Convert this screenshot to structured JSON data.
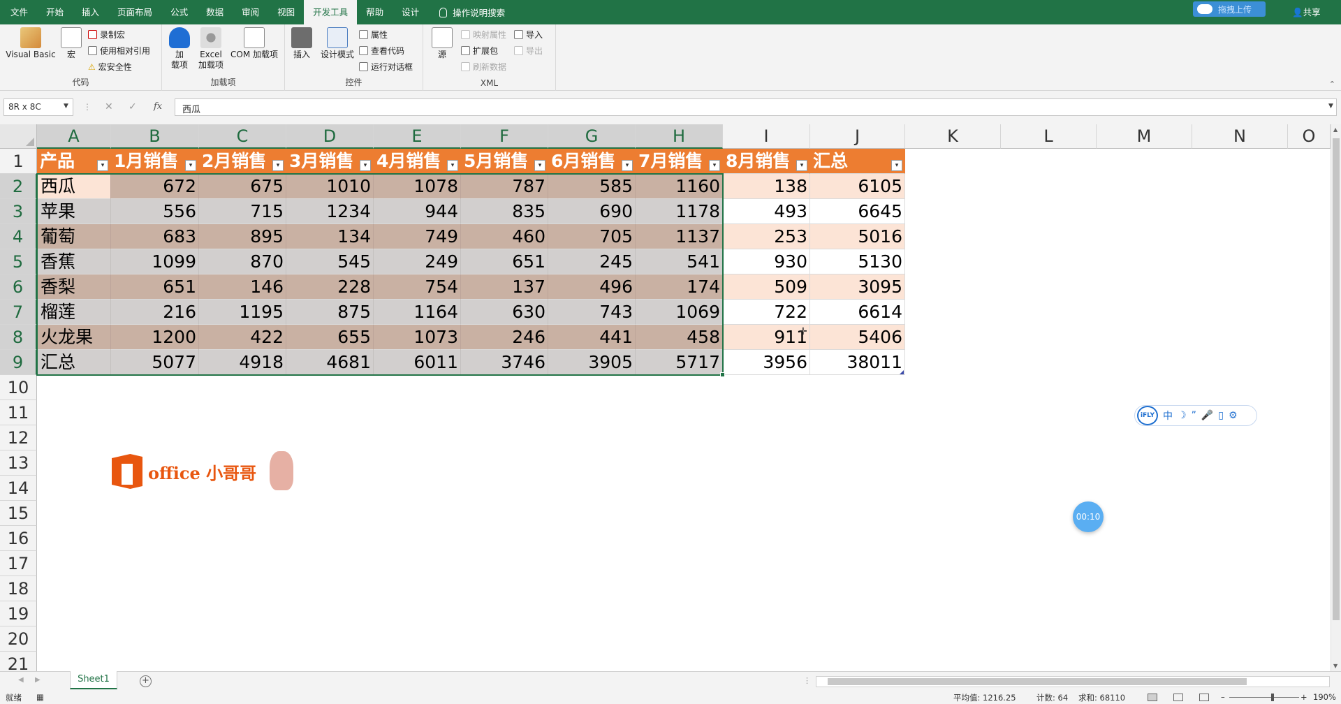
{
  "menu": {
    "tabs": [
      "文件",
      "开始",
      "插入",
      "页面布局",
      "公式",
      "数据",
      "审阅",
      "视图",
      "开发工具",
      "帮助",
      "设计"
    ],
    "active": "开发工具",
    "search": "操作说明搜索",
    "upload": "拖拽上传",
    "share": "共享"
  },
  "ribbon": {
    "code": {
      "label": "代码",
      "vb": "Visual Basic",
      "macros": "宏",
      "record": "录制宏",
      "relative": "使用相对引用",
      "security": "宏安全性"
    },
    "addins": {
      "label": "加载项",
      "addin_l1": "加",
      "addin_l2": "载项",
      "excel_l1": "Excel",
      "excel_l2": "加载项",
      "com": "COM 加载项"
    },
    "controls": {
      "label": "控件",
      "insert": "插入",
      "design": "设计模式",
      "properties": "属性",
      "viewcode": "查看代码",
      "dialog": "运行对话框"
    },
    "xml": {
      "label": "XML",
      "source": "源",
      "mapprops": "映射属性",
      "expansion": "扩展包",
      "refresh": "刷新数据",
      "import": "导入",
      "export": "导出"
    }
  },
  "formula_bar": {
    "namebox": "8R x 8C",
    "fx": "fx",
    "value": "西瓜"
  },
  "columns": [
    "A",
    "B",
    "C",
    "D",
    "E",
    "F",
    "G",
    "H",
    "I",
    "J",
    "K",
    "L",
    "M",
    "N",
    "O"
  ],
  "rows": [
    "1",
    "2",
    "3",
    "4",
    "5",
    "6",
    "7",
    "8",
    "9",
    "10",
    "11",
    "12",
    "13",
    "14",
    "15",
    "16",
    "17",
    "18",
    "19",
    "20",
    "21"
  ],
  "table": {
    "headers": [
      "产品",
      "1月销售",
      "2月销售",
      "3月销售",
      "4月销售",
      "5月销售",
      "6月销售",
      "7月销售",
      "8月销售",
      "汇总"
    ],
    "rows": [
      [
        "西瓜",
        "672",
        "675",
        "1010",
        "1078",
        "787",
        "585",
        "1160",
        "138",
        "6105"
      ],
      [
        "苹果",
        "556",
        "715",
        "1234",
        "944",
        "835",
        "690",
        "1178",
        "493",
        "6645"
      ],
      [
        "葡萄",
        "683",
        "895",
        "134",
        "749",
        "460",
        "705",
        "1137",
        "253",
        "5016"
      ],
      [
        "香蕉",
        "1099",
        "870",
        "545",
        "249",
        "651",
        "245",
        "541",
        "930",
        "5130"
      ],
      [
        "香梨",
        "651",
        "146",
        "228",
        "754",
        "137",
        "496",
        "174",
        "509",
        "3095"
      ],
      [
        "榴莲",
        "216",
        "1195",
        "875",
        "1164",
        "630",
        "743",
        "1069",
        "722",
        "6614"
      ],
      [
        "火龙果",
        "1200",
        "422",
        "655",
        "1073",
        "246",
        "441",
        "458",
        "911",
        "5406"
      ],
      [
        "汇总",
        "5077",
        "4918",
        "4681",
        "6011",
        "3746",
        "3905",
        "5717",
        "3956",
        "38011"
      ]
    ]
  },
  "logo": {
    "text": "office 小哥哥"
  },
  "ifly": {
    "logo": "iFLY",
    "lang": "中"
  },
  "timer": "00:10",
  "sheet": {
    "tab": "Sheet1"
  },
  "status": {
    "ready": "就绪",
    "average": "平均值: 1216.25",
    "count": "计数: 64",
    "sum": "求和: 68110",
    "zoom": "190%"
  },
  "colors": {
    "accent": "#217346",
    "header_fill": "#ED7D31",
    "band_dark": "#C9B1A3",
    "band_light": "#D2CFCE",
    "light_peach": "#FCE4D6"
  }
}
